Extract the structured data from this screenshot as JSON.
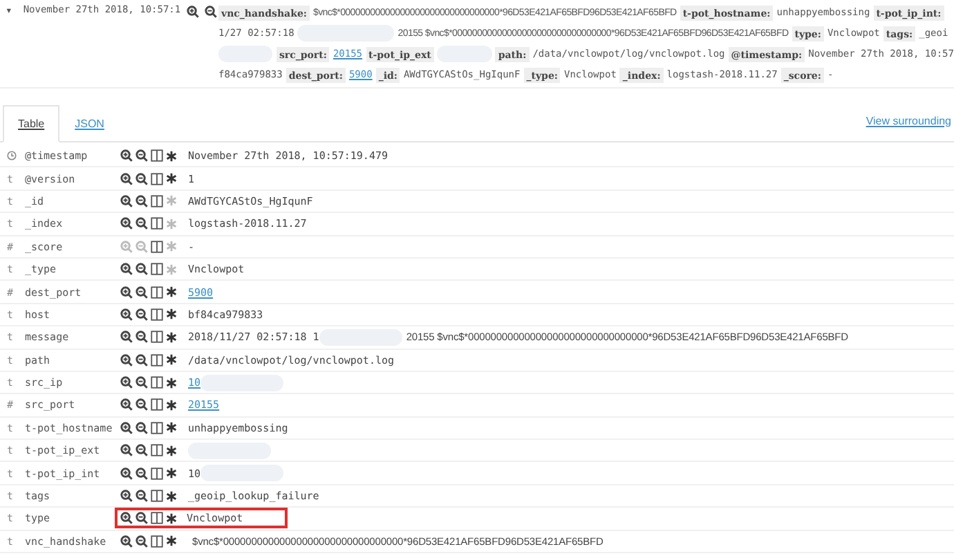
{
  "document": {
    "expand_glyph": "▾",
    "timestamp": "November 27th 2018, 10:57:1",
    "summary_lines": [
      [
        {
          "kind": "key",
          "text": "vnc_handshake:"
        },
        {
          "kind": "hash",
          "text": "$vnc$*00000000000000000000000000000000*96D53E421AF65BFD96D53E421AF65BFD"
        },
        {
          "kind": "key",
          "text": "t-pot_hostname:"
        },
        {
          "kind": "value",
          "text": "unhappyembossing"
        },
        {
          "kind": "key",
          "text": "t-pot_ip_int:"
        }
      ],
      [
        {
          "kind": "value",
          "text": "1/27 02:57:18"
        },
        {
          "kind": "blur"
        },
        {
          "kind": "hash",
          "text": "20155 $vnc$*00000000000000000000000000000000*96D53E421AF65BFD96D53E421AF65BFD"
        },
        {
          "kind": "key",
          "text": "type:"
        },
        {
          "kind": "value",
          "text": "Vnclowpot"
        },
        {
          "kind": "key",
          "text": "tags:"
        },
        {
          "kind": "value",
          "text": "_geoi"
        }
      ],
      [
        {
          "kind": "blur"
        },
        {
          "kind": "key",
          "text": "src_port:"
        },
        {
          "kind": "link",
          "text": "20155"
        },
        {
          "kind": "key",
          "text": "t-pot_ip_ext"
        },
        {
          "kind": "blur"
        },
        {
          "kind": "key",
          "text": "path:"
        },
        {
          "kind": "value",
          "text": "/data/vnclowpot/log/vnclowpot.log"
        },
        {
          "kind": "key",
          "text": "@timestamp:"
        },
        {
          "kind": "value",
          "text": "November 27th 2018, 10:57"
        }
      ],
      [
        {
          "kind": "value",
          "text": "f84ca979833"
        },
        {
          "kind": "key",
          "text": "dest_port:"
        },
        {
          "kind": "link",
          "text": "5900"
        },
        {
          "kind": "key",
          "text": "_id:"
        },
        {
          "kind": "value",
          "text": "AWdTGYCAStOs_HgIqunF"
        },
        {
          "kind": "key",
          "text": "_type:"
        },
        {
          "kind": "value",
          "text": "Vnclowpot"
        },
        {
          "kind": "key",
          "text": "_index:"
        },
        {
          "kind": "value",
          "text": "logstash-2018.11.27"
        },
        {
          "kind": "key",
          "text": "_score:"
        },
        {
          "kind": "value",
          "text": "-"
        }
      ]
    ]
  },
  "tabs": [
    {
      "label": "Table",
      "selected": true
    },
    {
      "label": "JSON",
      "selected": false
    }
  ],
  "view_surrounding": "View surrounding",
  "rows": [
    {
      "kind": "clock",
      "field": "@timestamp",
      "filter_enabled": true,
      "exists_enabled": true,
      "highlighted": false,
      "value": [
        {
          "kind": "text",
          "text": "November 27th 2018, 10:57:19.479"
        }
      ]
    },
    {
      "kind": "glyph",
      "type_glyph": "t",
      "field": "@version",
      "filter_enabled": true,
      "exists_enabled": true,
      "highlighted": false,
      "value": [
        {
          "kind": "text",
          "text": "1"
        }
      ]
    },
    {
      "kind": "glyph",
      "type_glyph": "t",
      "field": "_id",
      "filter_enabled": true,
      "exists_enabled": false,
      "highlighted": false,
      "value": [
        {
          "kind": "text",
          "text": "AWdTGYCAStOs_HgIqunF"
        }
      ]
    },
    {
      "kind": "glyph",
      "type_glyph": "t",
      "field": "_index",
      "filter_enabled": true,
      "exists_enabled": false,
      "highlighted": false,
      "value": [
        {
          "kind": "text",
          "text": "logstash-2018.11.27"
        }
      ]
    },
    {
      "kind": "glyph",
      "type_glyph": "#",
      "field": "_score",
      "filter_enabled": false,
      "exists_enabled": false,
      "highlighted": false,
      "value": [
        {
          "kind": "text",
          "text": "-"
        }
      ]
    },
    {
      "kind": "glyph",
      "type_glyph": "t",
      "field": "_type",
      "filter_enabled": true,
      "exists_enabled": false,
      "highlighted": false,
      "value": [
        {
          "kind": "text",
          "text": "Vnclowpot"
        }
      ]
    },
    {
      "kind": "glyph",
      "type_glyph": "#",
      "field": "dest_port",
      "filter_enabled": true,
      "exists_enabled": true,
      "highlighted": false,
      "value": [
        {
          "kind": "link",
          "text": "5900"
        }
      ]
    },
    {
      "kind": "glyph",
      "type_glyph": "t",
      "field": "host",
      "filter_enabled": true,
      "exists_enabled": true,
      "highlighted": false,
      "value": [
        {
          "kind": "text",
          "text": "bf84ca979833"
        }
      ]
    },
    {
      "kind": "glyph",
      "type_glyph": "t",
      "field": "message",
      "filter_enabled": true,
      "exists_enabled": true,
      "highlighted": false,
      "value": [
        {
          "kind": "text",
          "text": "2018/11/27 02:57:18 1"
        },
        {
          "kind": "blur"
        },
        {
          "kind": "hash",
          "text": "20155 $vnc$*00000000000000000000000000000000*96D53E421AF65BFD96D53E421AF65BFD"
        }
      ]
    },
    {
      "kind": "glyph",
      "type_glyph": "t",
      "field": "path",
      "filter_enabled": true,
      "exists_enabled": true,
      "highlighted": false,
      "value": [
        {
          "kind": "text",
          "text": "/data/vnclowpot/log/vnclowpot.log"
        }
      ]
    },
    {
      "kind": "glyph",
      "type_glyph": "t",
      "field": "src_ip",
      "filter_enabled": true,
      "exists_enabled": true,
      "highlighted": false,
      "value": [
        {
          "kind": "link",
          "text": "10"
        },
        {
          "kind": "blur"
        }
      ]
    },
    {
      "kind": "glyph",
      "type_glyph": "#",
      "field": "src_port",
      "filter_enabled": true,
      "exists_enabled": true,
      "highlighted": false,
      "value": [
        {
          "kind": "link",
          "text": "20155"
        }
      ]
    },
    {
      "kind": "glyph",
      "type_glyph": "t",
      "field": "t-pot_hostname",
      "filter_enabled": true,
      "exists_enabled": true,
      "highlighted": false,
      "value": [
        {
          "kind": "text",
          "text": "unhappyembossing"
        }
      ]
    },
    {
      "kind": "glyph",
      "type_glyph": "t",
      "field": "t-pot_ip_ext",
      "filter_enabled": true,
      "exists_enabled": true,
      "highlighted": false,
      "value": [
        {
          "kind": "blur"
        }
      ]
    },
    {
      "kind": "glyph",
      "type_glyph": "t",
      "field": "t-pot_ip_int",
      "filter_enabled": true,
      "exists_enabled": true,
      "highlighted": false,
      "value": [
        {
          "kind": "text",
          "text": "10"
        },
        {
          "kind": "blur"
        }
      ]
    },
    {
      "kind": "glyph",
      "type_glyph": "t",
      "field": "tags",
      "filter_enabled": true,
      "exists_enabled": true,
      "highlighted": false,
      "value": [
        {
          "kind": "text",
          "text": "_geoip_lookup_failure"
        }
      ]
    },
    {
      "kind": "glyph",
      "type_glyph": "t",
      "field": "type",
      "filter_enabled": true,
      "exists_enabled": true,
      "highlighted": true,
      "value": [
        {
          "kind": "text",
          "text": "Vnclowpot"
        }
      ]
    },
    {
      "kind": "glyph",
      "type_glyph": "t",
      "field": "vnc_handshake",
      "filter_enabled": true,
      "exists_enabled": true,
      "highlighted": false,
      "value": [
        {
          "kind": "hash",
          "text": "$vnc$*00000000000000000000000000000000*96D53E421AF65BFD96D53E421AF65BFD"
        }
      ]
    }
  ]
}
